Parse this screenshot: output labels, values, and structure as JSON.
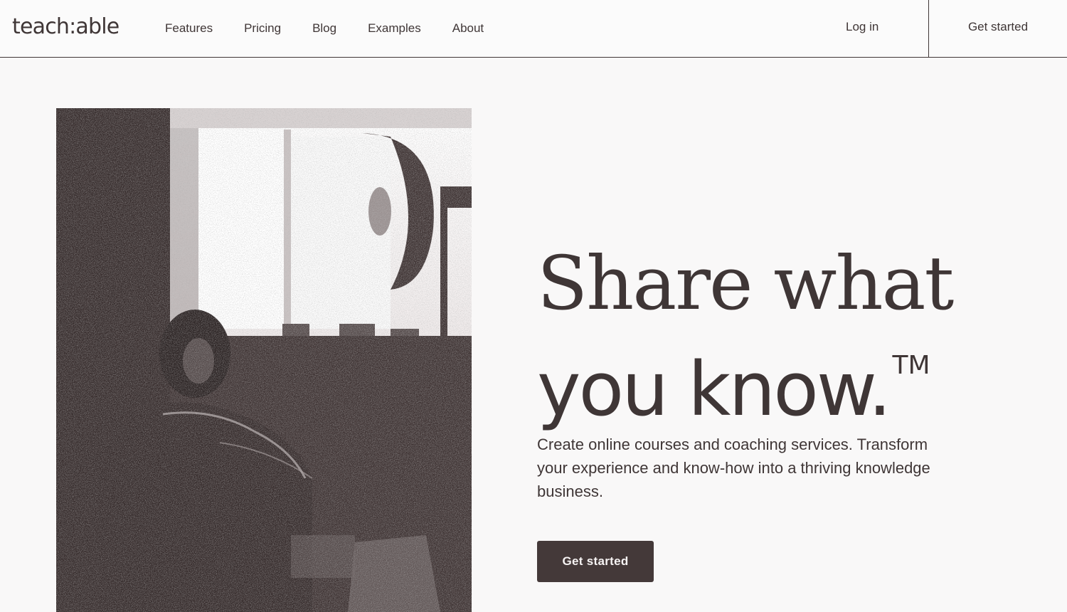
{
  "header": {
    "logo": "teach:able",
    "nav": [
      "Features",
      "Pricing",
      "Blog",
      "Examples",
      "About"
    ],
    "login_label": "Log in",
    "cta_label": "Get started"
  },
  "hero": {
    "image_alt_icon": "photo-icon",
    "headline_line1": "Share what",
    "headline_line2": "you know.",
    "headline_tm": "TM",
    "subtext": "Create online courses and coaching services. Transform your experience and know-how into a thriving knowledge business.",
    "cta_label": "Get started"
  },
  "colors": {
    "ink": "#3f3636",
    "background": "#f9f8f8",
    "button": "#443939"
  }
}
